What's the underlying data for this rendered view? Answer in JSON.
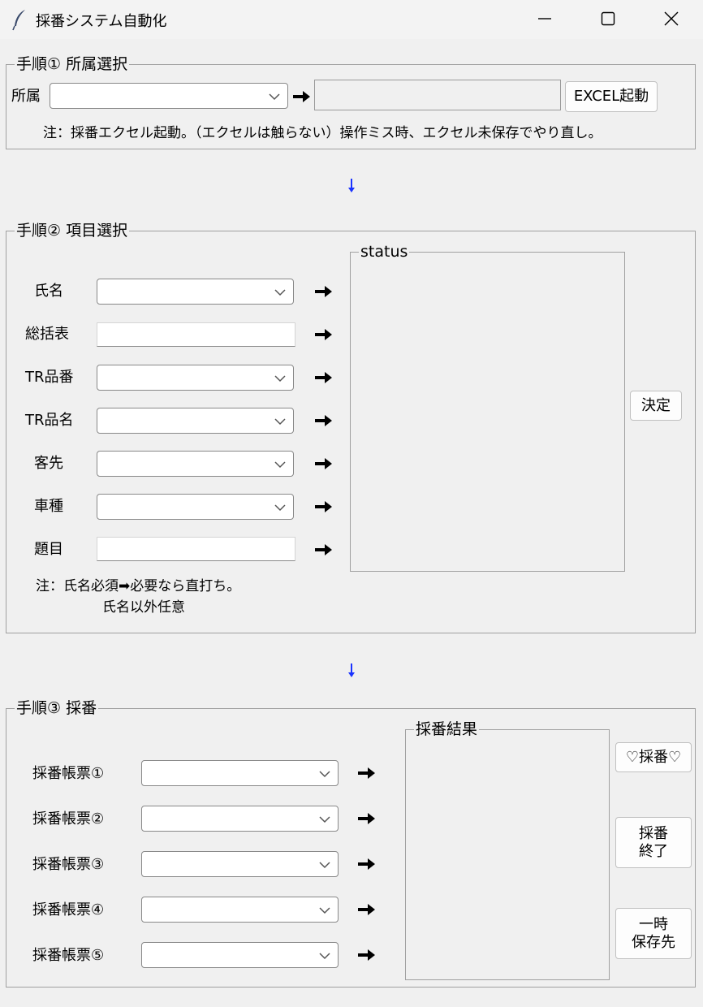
{
  "window": {
    "title": "採番システム自動化",
    "controls": [
      "minimize-icon",
      "maximize-icon",
      "close-icon"
    ]
  },
  "step1": {
    "title": "手順① 所属選択",
    "affiliation_label": "所属",
    "affiliation_value": "",
    "path_value": "",
    "excel_button": "EXCEL起動",
    "note": "注：採番エクセル起動。（エクセルは触らない）操作ミス時、エクセル未保存でやり直し。"
  },
  "step2": {
    "title": "手順② 項目選択",
    "fields": [
      {
        "label": "氏名",
        "type": "combo",
        "value": ""
      },
      {
        "label": "総括表",
        "type": "entry",
        "value": ""
      },
      {
        "label": "TR品番",
        "type": "combo",
        "value": ""
      },
      {
        "label": "TR品名",
        "type": "combo",
        "value": ""
      },
      {
        "label": "客先",
        "type": "combo",
        "value": ""
      },
      {
        "label": "車種",
        "type": "combo",
        "value": ""
      },
      {
        "label": "題目",
        "type": "entry",
        "value": ""
      }
    ],
    "status_title": "status",
    "decide_button": "決定",
    "note_line1": "注：氏名必須➡必要なら直打ち。",
    "note_line2": "氏名以外任意"
  },
  "step3": {
    "title": "手順③ 採番",
    "forms": [
      {
        "label": "採番帳票①",
        "value": ""
      },
      {
        "label": "採番帳票②",
        "value": ""
      },
      {
        "label": "採番帳票③",
        "value": ""
      },
      {
        "label": "採番帳票④",
        "value": ""
      },
      {
        "label": "採番帳票⑤",
        "value": ""
      }
    ],
    "result_title": "採番結果",
    "number_button": "♡採番♡",
    "finish_button": "採番\n終了",
    "temp_save_button": "一時\n保存先"
  },
  "colors": {
    "background": "#f0f0f0",
    "flow_arrow": "#1a33ff"
  }
}
